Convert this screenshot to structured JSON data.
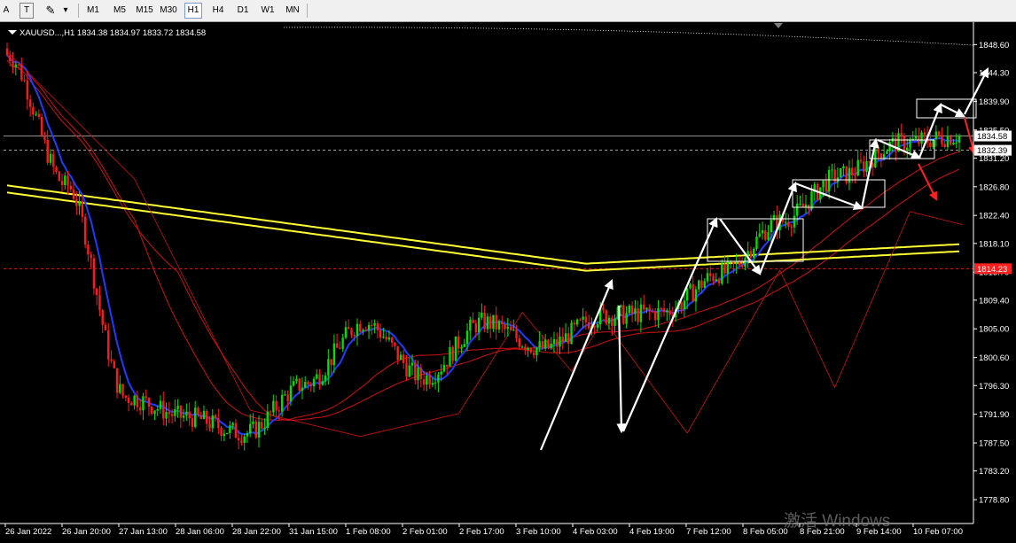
{
  "toolbar": {
    "left_glyph": "A",
    "text_tool": "T",
    "draw_tool": "✎",
    "dropdown": "▾",
    "timeframes": [
      {
        "label": "M1",
        "active": false
      },
      {
        "label": "M5",
        "active": false
      },
      {
        "label": "M15",
        "active": false
      },
      {
        "label": "M30",
        "active": false
      },
      {
        "label": "H1",
        "active": true
      },
      {
        "label": "H4",
        "active": false
      },
      {
        "label": "D1",
        "active": false
      },
      {
        "label": "W1",
        "active": false
      },
      {
        "label": "MN",
        "active": false
      }
    ]
  },
  "chart": {
    "symbol_line": "XAUUSD...,H1  1834.38 1834.97 1833.72 1834.58",
    "current_price": "1834.58",
    "line_prices": [
      "1832.39",
      "1814.23"
    ],
    "y_ticks": [
      "1848.60",
      "1844.30",
      "1839.90",
      "1835.50",
      "1831.20",
      "1826.80",
      "1822.40",
      "1818.10",
      "1813.70",
      "1809.40",
      "1805.00",
      "1800.60",
      "1796.30",
      "1791.90",
      "1787.50",
      "1783.20",
      "1778.80"
    ],
    "x_ticks": [
      "26 Jan 2022",
      "26 Jan 20:00",
      "27 Jan 13:00",
      "28 Jan 06:00",
      "28 Jan 22:00",
      "31 Jan 15:00",
      "1 Feb 08:00",
      "2 Feb 01:00",
      "2 Feb 17:00",
      "3 Feb 10:00",
      "4 Feb 03:00",
      "4 Feb 19:00",
      "7 Feb 12:00",
      "8 Feb 05:00",
      "8 Feb 21:00",
      "9 Feb 14:00",
      "10 Feb 07:00"
    ],
    "colors": {
      "bull": "#00e000",
      "bear": "#ff1a1a",
      "fast_ma": "#1e3cff",
      "slow_ma": "#ffff33",
      "red_ma": "#d01010",
      "grid_line": "#c0c0c0",
      "dashed_level": "#ff2020",
      "arrow": "#ffffff",
      "down_arrow": "#ff2020"
    }
  },
  "chart_data": {
    "type": "candlestick",
    "title": "XAUUSD...,H1",
    "ohlc_last": {
      "open": 1834.38,
      "high": 1834.97,
      "low": 1833.72,
      "close": 1834.58
    },
    "ylim": [
      1776.5,
      1851.5
    ],
    "x": [
      "26 Jan 2022",
      "26 Jan 20:00",
      "27 Jan 13:00",
      "28 Jan 06:00",
      "28 Jan 22:00",
      "31 Jan 15:00",
      "1 Feb 08:00",
      "2 Feb 01:00",
      "2 Feb 17:00",
      "3 Feb 10:00",
      "4 Feb 03:00",
      "4 Feb 19:00",
      "7 Feb 12:00",
      "8 Feb 05:00",
      "8 Feb 21:00",
      "9 Feb 14:00",
      "10 Feb 07:00"
    ],
    "close_at_x_ticks": [
      1847.0,
      1827.0,
      1794.5,
      1791.5,
      1789.0,
      1796.5,
      1806.0,
      1797.5,
      1806.0,
      1802.0,
      1807.0,
      1807.5,
      1813.5,
      1821.5,
      1828.5,
      1833.5,
      1834.58
    ],
    "horizontal_levels": [
      1834.58,
      1832.39,
      1814.23
    ]
  }
}
